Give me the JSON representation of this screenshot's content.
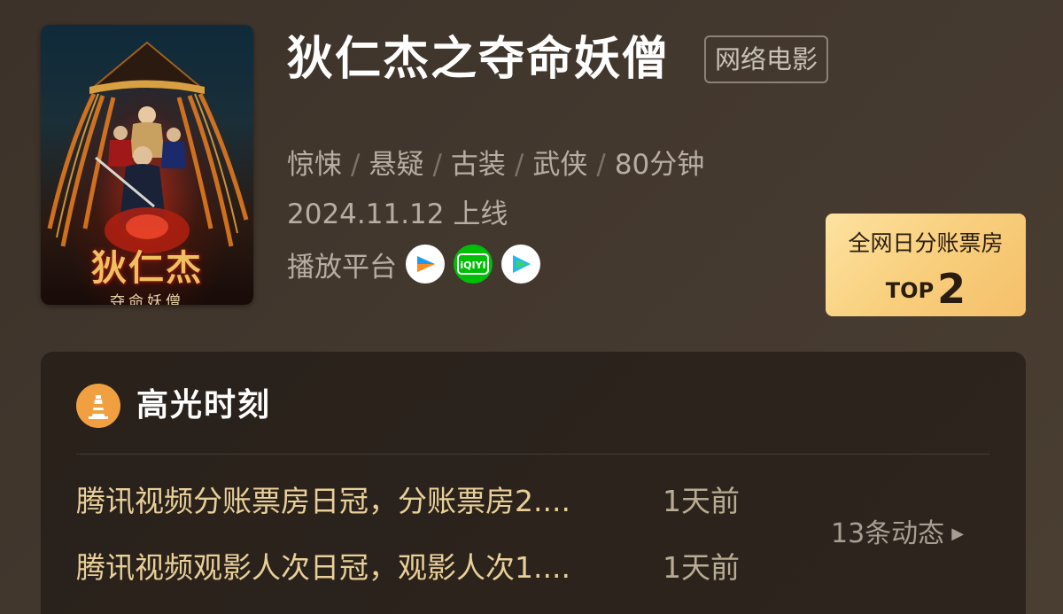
{
  "movie": {
    "title": "狄仁杰之夺命妖僧",
    "type_tag": "网络电影",
    "genres": [
      "惊悚",
      "悬疑",
      "古装",
      "武侠"
    ],
    "separator": "/",
    "duration": "80分钟",
    "release": "2024.11.12 上线",
    "platform_label": "播放平台",
    "platforms": [
      {
        "name": "优酷",
        "icon": "youku-icon",
        "color": "#1e9bf0"
      },
      {
        "name": "爱奇艺",
        "icon": "iqiyi-icon",
        "color": "#00be06"
      },
      {
        "name": "腾讯视频",
        "icon": "tencent-video-icon",
        "color": "#20b8f5"
      }
    ],
    "poster": {
      "title_text": "狄仁杰",
      "subtitle_text": "夺命妖僧"
    }
  },
  "rank_badge": {
    "label": "全网日分账票房",
    "top_label": "TOP",
    "top_value": "2"
  },
  "highlights": {
    "title": "高光时刻",
    "icon": "lighthouse-icon",
    "items": [
      {
        "text": "腾讯视频分账票房日冠，分账票房2....",
        "time": "1天前"
      },
      {
        "text": "腾讯视频观影人次日冠，观影人次1....",
        "time": "1天前"
      }
    ],
    "more_label": "13条动态",
    "more_icon": "triangle-right-icon"
  }
}
